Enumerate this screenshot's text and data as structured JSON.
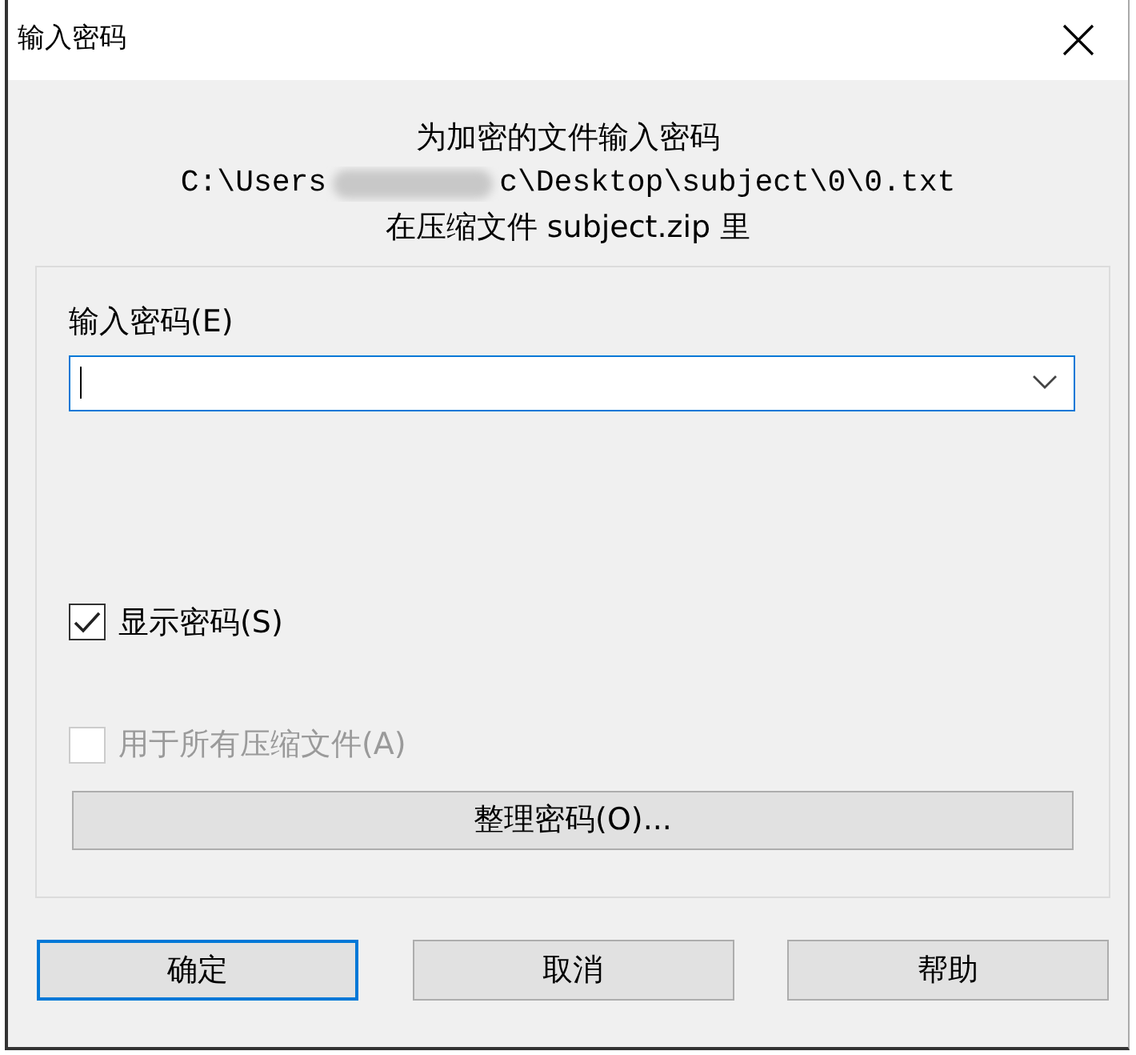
{
  "window": {
    "title": "输入密码"
  },
  "header": {
    "line_1": "为加密的文件输入密码",
    "path_start": "C:\\Users",
    "path_end": "c\\Desktop\\subject\\0\\0.txt",
    "line_3": "在压缩文件 subject.zip 里"
  },
  "password": {
    "label": "输入密码(E)"
  },
  "checkboxes": [
    {
      "label": "显示密码(S)",
      "checked": true,
      "disabled": false
    },
    {
      "label": "用于所有压缩文件(A)",
      "checked": false,
      "disabled": true
    }
  ],
  "manage_button": "整理密码(O)...",
  "buttons": [
    {
      "label": "确定",
      "default": true
    },
    {
      "label": "取消",
      "default": false
    },
    {
      "label": "帮助",
      "default": false
    }
  ]
}
